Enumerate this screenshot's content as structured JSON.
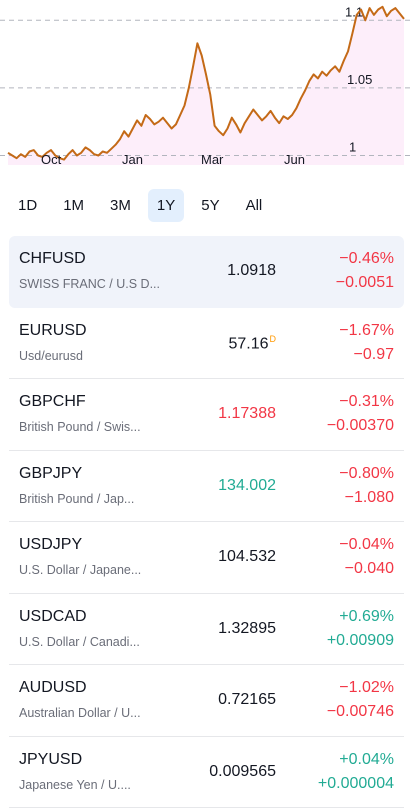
{
  "chart_data": {
    "type": "area",
    "x_labels": [
      "Oct",
      "Jan",
      "Mar",
      "Jun"
    ],
    "y_ticks": [
      1,
      1.05,
      1.1
    ],
    "ylim": [
      0.993,
      1.115
    ],
    "grid": true,
    "line_color": "#c46a17",
    "fill_color": "#fdeefa",
    "values": [
      1.002,
      1.0,
      0.998,
      1.001,
      0.999,
      1.003,
      1.004,
      1.0,
      0.999,
      1.002,
      1.004,
      1.0,
      0.998,
      0.997,
      1.001,
      1.004,
      1.0,
      1.002,
      1.006,
      1.004,
      1.001,
      1.0,
      1.003,
      1.002,
      1.005,
      1.008,
      1.012,
      1.018,
      1.014,
      1.02,
      1.026,
      1.022,
      1.03,
      1.027,
      1.023,
      1.025,
      1.028,
      1.024,
      1.02,
      1.023,
      1.03,
      1.037,
      1.05,
      1.066,
      1.083,
      1.074,
      1.06,
      1.045,
      1.022,
      1.018,
      1.015,
      1.02,
      1.028,
      1.023,
      1.017,
      1.024,
      1.029,
      1.034,
      1.03,
      1.026,
      1.029,
      1.033,
      1.028,
      1.024,
      1.029,
      1.027,
      1.03,
      1.035,
      1.042,
      1.048,
      1.055,
      1.06,
      1.057,
      1.062,
      1.059,
      1.063,
      1.066,
      1.062,
      1.07,
      1.077,
      1.09,
      1.104,
      1.108,
      1.1,
      1.109,
      1.104,
      1.108,
      1.11,
      1.103,
      1.107,
      1.109,
      1.105,
      1.101
    ]
  },
  "ranges": {
    "items": [
      "1D",
      "1M",
      "3M",
      "1Y",
      "5Y",
      "All"
    ],
    "active": "1Y"
  },
  "watchlist": [
    {
      "symbol": "CHFUSD",
      "description": "SWISS FRANC / U.S D...",
      "price": "1.0918",
      "price_color": "",
      "delayed": "",
      "change_pct": "−0.46%",
      "change_abs": "−0.0051",
      "dir": "neg",
      "selected": true
    },
    {
      "symbol": "EURUSD",
      "description": "Usd/eurusd",
      "price": "57.16",
      "price_color": "",
      "delayed": "D",
      "change_pct": "−1.67%",
      "change_abs": "−0.97",
      "dir": "neg",
      "selected": false
    },
    {
      "symbol": "GBPCHF",
      "description": "British Pound / Swis...",
      "price": "1.17388",
      "price_color": "neg",
      "delayed": "",
      "change_pct": "−0.31%",
      "change_abs": "−0.00370",
      "dir": "neg",
      "selected": false
    },
    {
      "symbol": "GBPJPY",
      "description": "British Pound / Jap...",
      "price": "134.002",
      "price_color": "pos",
      "delayed": "",
      "change_pct": "−0.80%",
      "change_abs": "−1.080",
      "dir": "neg",
      "selected": false
    },
    {
      "symbol": "USDJPY",
      "description": "U.S. Dollar / Japane...",
      "price": "104.532",
      "price_color": "",
      "delayed": "",
      "change_pct": "−0.04%",
      "change_abs": "−0.040",
      "dir": "neg",
      "selected": false
    },
    {
      "symbol": "USDCAD",
      "description": "U.S. Dollar / Canadi...",
      "price": "1.32895",
      "price_color": "",
      "delayed": "",
      "change_pct": "+0.69%",
      "change_abs": "+0.00909",
      "dir": "pos",
      "selected": false
    },
    {
      "symbol": "AUDUSD",
      "description": "Australian Dollar / U...",
      "price": "0.72165",
      "price_color": "",
      "delayed": "",
      "change_pct": "−1.02%",
      "change_abs": "−0.00746",
      "dir": "neg",
      "selected": false
    },
    {
      "symbol": "JPYUSD",
      "description": "Japanese Yen / U....",
      "price": "0.009565",
      "price_color": "",
      "delayed": "",
      "change_pct": "+0.04%",
      "change_abs": "+0.000004",
      "dir": "pos",
      "selected": false
    }
  ]
}
